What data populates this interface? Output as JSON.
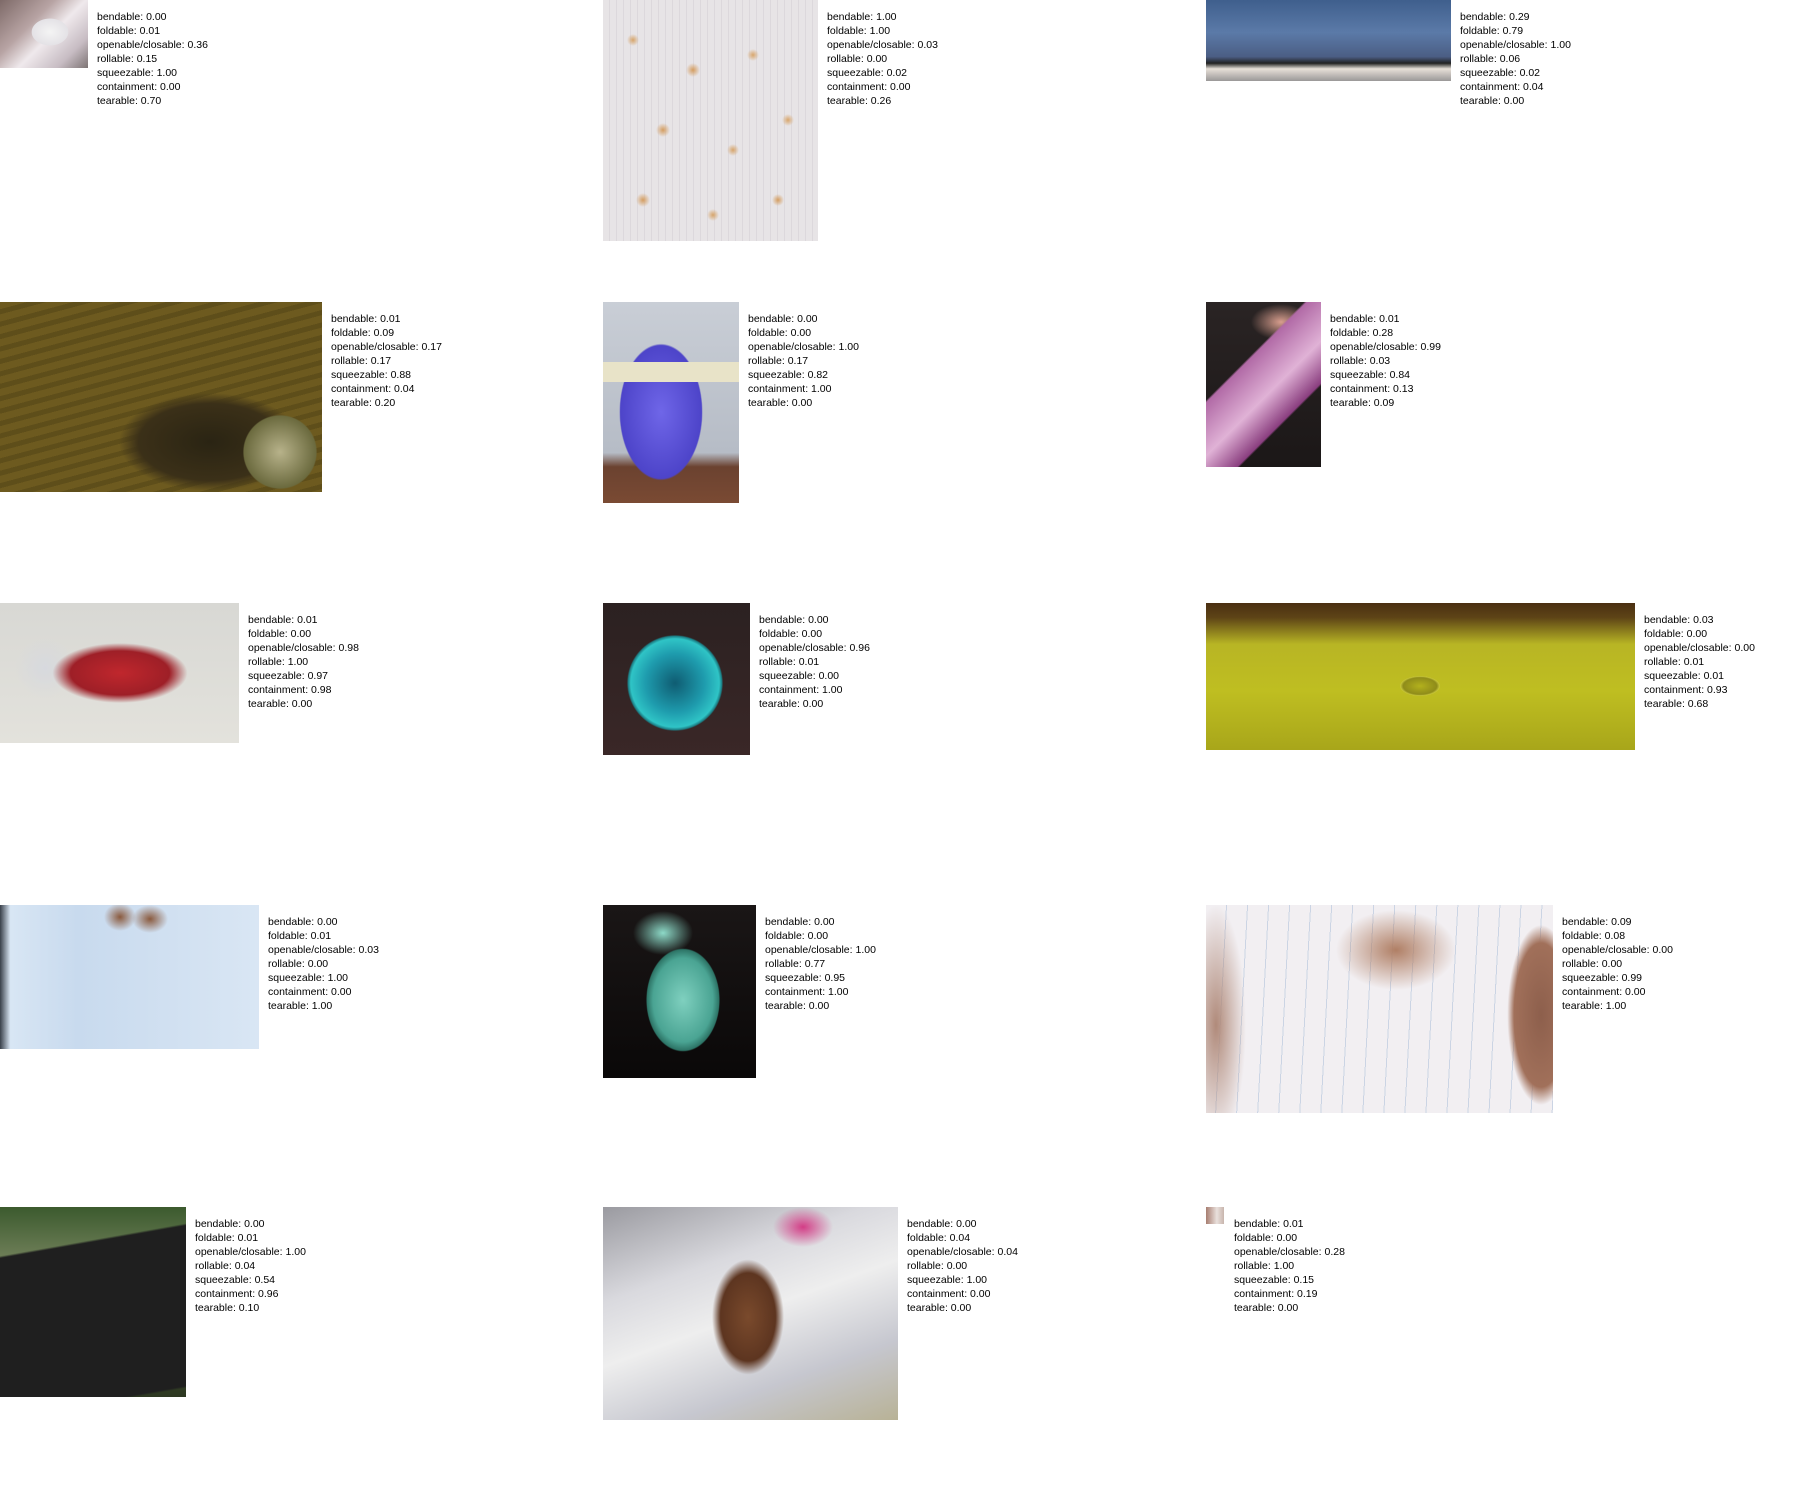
{
  "labels": {
    "bendable": "bendable",
    "foldable": "foldable",
    "openable": "openable/closable",
    "rollable": "rollable",
    "squeezable": "squeezable",
    "containment": "containment",
    "tearable": "tearable"
  },
  "items": [
    {
      "bendable": "0.00",
      "foldable": "0.01",
      "openable": "0.36",
      "rollable": "0.15",
      "squeezable": "1.00",
      "containment": "0.00",
      "tearable": "0.70"
    },
    {
      "bendable": "1.00",
      "foldable": "1.00",
      "openable": "0.03",
      "rollable": "0.00",
      "squeezable": "0.02",
      "containment": "0.00",
      "tearable": "0.26"
    },
    {
      "bendable": "0.29",
      "foldable": "0.79",
      "openable": "1.00",
      "rollable": "0.06",
      "squeezable": "0.02",
      "containment": "0.04",
      "tearable": "0.00"
    },
    {
      "bendable": "0.01",
      "foldable": "0.09",
      "openable": "0.17",
      "rollable": "0.17",
      "squeezable": "0.88",
      "containment": "0.04",
      "tearable": "0.20"
    },
    {
      "bendable": "0.00",
      "foldable": "0.00",
      "openable": "1.00",
      "rollable": "0.17",
      "squeezable": "0.82",
      "containment": "1.00",
      "tearable": "0.00"
    },
    {
      "bendable": "0.01",
      "foldable": "0.28",
      "openable": "0.99",
      "rollable": "0.03",
      "squeezable": "0.84",
      "containment": "0.13",
      "tearable": "0.09"
    },
    {
      "bendable": "0.01",
      "foldable": "0.00",
      "openable": "0.98",
      "rollable": "1.00",
      "squeezable": "0.97",
      "containment": "0.98",
      "tearable": "0.00"
    },
    {
      "bendable": "0.00",
      "foldable": "0.00",
      "openable": "0.96",
      "rollable": "0.01",
      "squeezable": "0.00",
      "containment": "1.00",
      "tearable": "0.00"
    },
    {
      "bendable": "0.03",
      "foldable": "0.00",
      "openable": "0.00",
      "rollable": "0.01",
      "squeezable": "0.01",
      "containment": "0.93",
      "tearable": "0.68"
    },
    {
      "bendable": "0.00",
      "foldable": "0.01",
      "openable": "0.03",
      "rollable": "0.00",
      "squeezable": "1.00",
      "containment": "0.00",
      "tearable": "1.00"
    },
    {
      "bendable": "0.00",
      "foldable": "0.00",
      "openable": "1.00",
      "rollable": "0.77",
      "squeezable": "0.95",
      "containment": "1.00",
      "tearable": "0.00"
    },
    {
      "bendable": "0.09",
      "foldable": "0.08",
      "openable": "0.00",
      "rollable": "0.00",
      "squeezable": "0.99",
      "containment": "0.00",
      "tearable": "1.00"
    },
    {
      "bendable": "0.00",
      "foldable": "0.01",
      "openable": "1.00",
      "rollable": "0.04",
      "squeezable": "0.54",
      "containment": "0.96",
      "tearable": "0.10"
    },
    {
      "bendable": "0.00",
      "foldable": "0.04",
      "openable": "0.04",
      "rollable": "0.00",
      "squeezable": "1.00",
      "containment": "0.00",
      "tearable": "0.00"
    },
    {
      "bendable": "0.01",
      "foldable": "0.00",
      "openable": "0.28",
      "rollable": "1.00",
      "squeezable": "0.15",
      "containment": "0.19",
      "tearable": "0.00"
    }
  ]
}
